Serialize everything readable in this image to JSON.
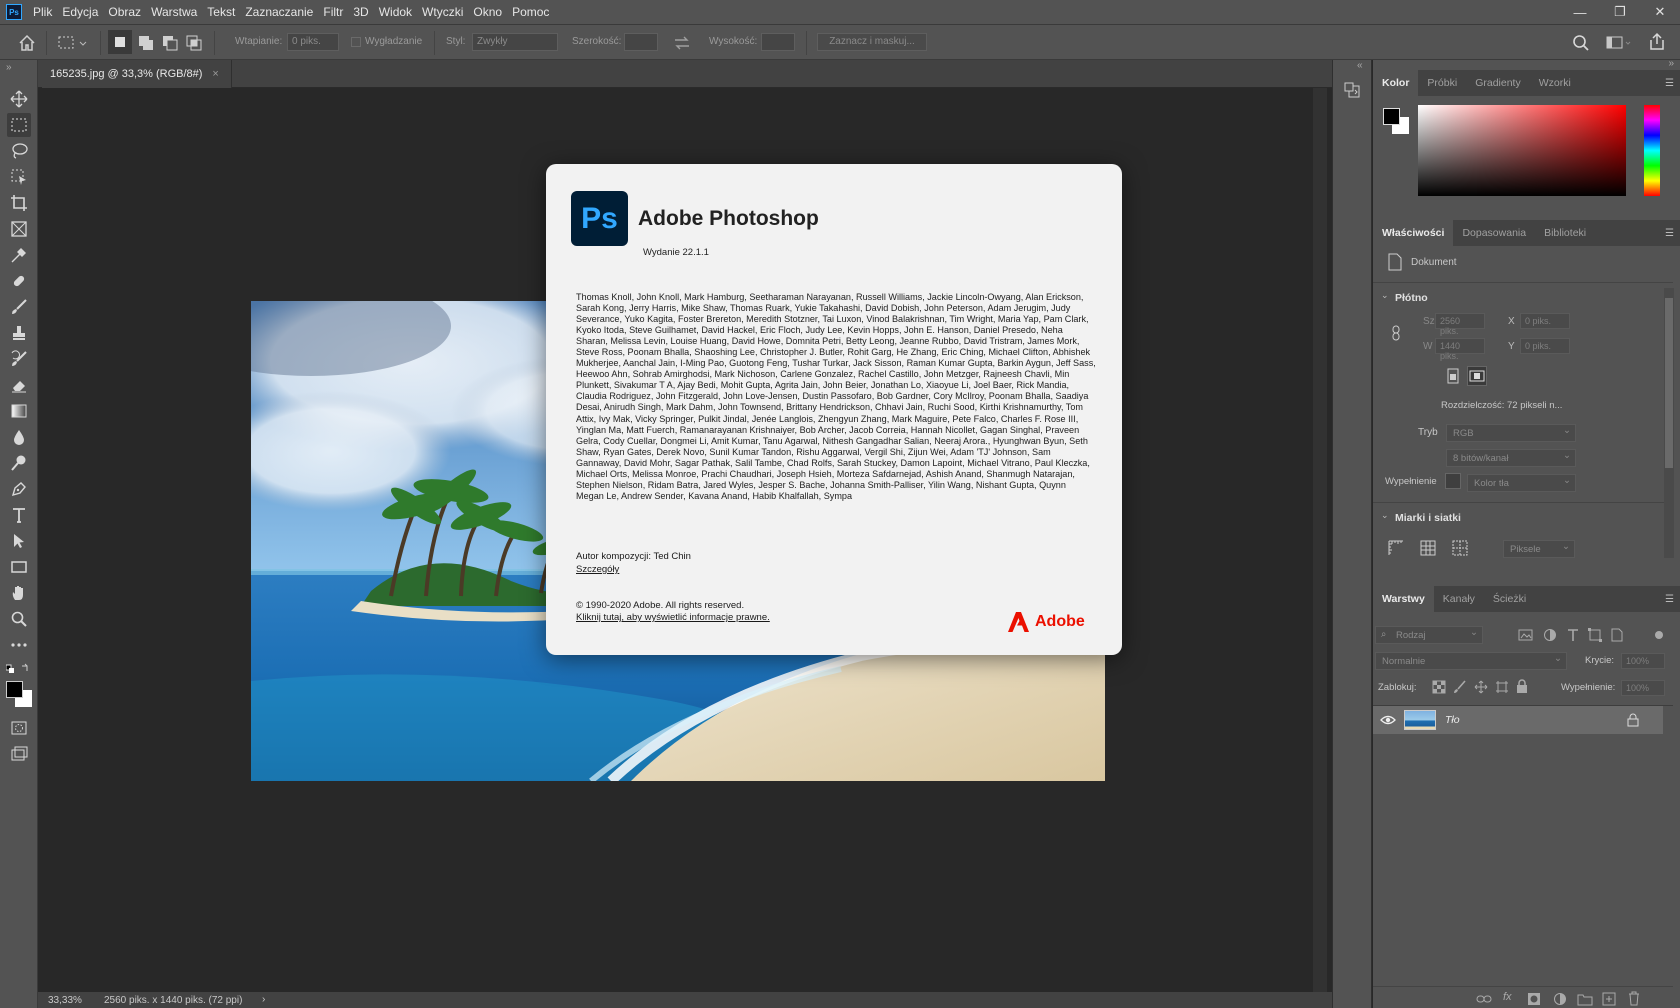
{
  "app": {
    "logo": "Ps"
  },
  "menu": [
    "Plik",
    "Edycja",
    "Obraz",
    "Warstwa",
    "Tekst",
    "Zaznaczanie",
    "Filtr",
    "3D",
    "Widok",
    "Wtyczki",
    "Okno",
    "Pomoc"
  ],
  "window_controls": {
    "minimize": "—",
    "restore": "❐",
    "close": "✕"
  },
  "options": {
    "feather_label": "Wtapianie:",
    "feather_value": "0 piks.",
    "antialias_label": "Wygładzanie",
    "style_label": "Styl:",
    "style_value": "Zwykły",
    "width_label": "Szerokość:",
    "height_label": "Wysokość:",
    "select_mask": "Zaznacz i maskuj..."
  },
  "document": {
    "tab_title": "165235.jpg @ 33,3% (RGB/8#)",
    "close": "×"
  },
  "status": {
    "zoom": "33,33%",
    "info": "2560 piks. x 1440 piks. (72 ppi)",
    "arrow": "›"
  },
  "color_panel": {
    "tabs": [
      "Kolor",
      "Próbki",
      "Gradienty",
      "Wzorki"
    ]
  },
  "properties_panel": {
    "tabs": [
      "Właściwości",
      "Dopasowania",
      "Biblioteki"
    ],
    "doc_label": "Dokument",
    "canvas_title": "Płótno",
    "w_label": "Sz",
    "w_value": "2560 piks.",
    "x_label": "X",
    "x_value": "0 piks.",
    "h_label": "W",
    "h_value": "1440 piks.",
    "y_label": "Y",
    "y_value": "0 piks.",
    "resolution": "Rozdzielczość: 72 pikseli n...",
    "mode_label": "Tryb",
    "mode_value": "RGB",
    "bits_value": "8 bitów/kanał",
    "fill_label": "Wypełnienie",
    "fill_value": "Kolor tła",
    "rulers_title": "Miarki i siatki",
    "units_value": "Piksele"
  },
  "layers_panel": {
    "tabs": [
      "Warstwy",
      "Kanały",
      "Ścieżki"
    ],
    "kind_placeholder": "Rodzaj",
    "blend_mode": "Normalnie",
    "opacity_label": "Krycie:",
    "opacity_value": "100%",
    "lock_label": "Zablokuj:",
    "fill_label": "Wypełnienie:",
    "fill_value": "100%",
    "layer_name": "Tło"
  },
  "about": {
    "logo": "Ps",
    "title": "Adobe Photoshop",
    "version": "Wydanie 22.1.1",
    "credits": "Thomas Knoll, John Knoll, Mark Hamburg, Seetharaman Narayanan, Russell Williams, Jackie Lincoln-Owyang, Alan Erickson, Sarah Kong, Jerry Harris, Mike Shaw, Thomas Ruark, Yukie Takahashi, David Dobish, John Peterson, Adam Jerugim, Judy Severance, Yuko Kagita, Foster Brereton, Meredith Stotzner, Tai Luxon, Vinod Balakrishnan, Tim Wright, Maria Yap, Pam Clark, Kyoko Itoda, Steve Guilhamet, David Hackel, Eric Floch, Judy Lee, Kevin Hopps, John E. Hanson, Daniel Presedo, Neha Sharan, Melissa Levin, Louise Huang, David Howe, Domnita Petri, Betty Leong, Jeanne Rubbo, David Tristram, James Mork, Steve Ross, Poonam Bhalla, Shaoshing Lee, Christopher J. Butler, Rohit Garg, He Zhang, Eric Ching, Michael Clifton, Abhishek Mukherjee, Aanchal Jain, I-Ming Pao, Guotong Feng, Tushar Turkar, Jack Sisson, Raman Kumar Gupta, Barkin Aygun, Jeff Sass, Heewoo Ahn, Sohrab Amirghodsi, Mark Nichoson, Carlene Gonzalez, Rachel Castillo, John Metzger, Rajneesh Chavli, Min Plunkett, Sivakumar T A, Ajay Bedi, Mohit Gupta, Agrita Jain, John Beier, Jonathan Lo, Xiaoyue Li, Joel Baer, Rick Mandia, Claudia Rodriguez, John Fitzgerald, John Love-Jensen, Dustin Passofaro, Bob Gardner, Cory McIlroy, Poonam Bhalla, Saadiya Desai, Anirudh Singh, Mark Dahm, John Townsend, Brittany Hendrickson, Chhavi Jain, Ruchi Sood, Kirthi Krishnamurthy, Tom Attix, Ivy Mak, Vicky Springer, Pulkit Jindal, Jenée Langlois, Zhengyun Zhang, Mark Maguire, Pete Falco, Charles F. Rose III, Yinglan Ma, Matt Fuerch, Ramanarayanan Krishnaiyer, Bob Archer, Jacob Correia, Hannah Nicollet, Gagan Singhal, Praveen Gelra, Cody Cuellar, Dongmei Li, Amit Kumar, Tanu Agarwal, Nithesh Gangadhar Salian, Neeraj Arora., Hyunghwan Byun, Seth Shaw, Ryan Gates, Derek Novo, Sunil Kumar Tandon, Rishu Aggarwal, Vergil Shi, Zijun Wei, Adam 'TJ' Johnson, Sam Gannaway, David Mohr, Sagar Pathak, Salil Tambe, Chad Rolfs, Sarah Stuckey, Damon Lapoint, Michael Vitrano, Paul Kleczka, Michael Orts, Melissa Monroe, Prachi Chaudhari, Joseph Hsieh, Morteza Safdarnejad, Ashish Anand, Shanmugh Natarajan, Stephen Nielson, Ridam Batra, Jared Wyles, Jesper S. Bache, Johanna Smith-Palliser, Yilin Wang, Nishant Gupta, Quynn Megan Le, Andrew Sender, Kavana Anand, Habib Khalfallah, Sympa",
    "author": "Autor kompozycji: Ted Chin",
    "details": "Szczegóły",
    "copyright": "© 1990-2020 Adobe. All rights reserved.",
    "legal": "Kliknij tutaj, aby wyświetlić informacje prawne.",
    "brand": "Adobe"
  },
  "colors": {
    "accent": "#31a8ff",
    "adobe_red": "#eb1000",
    "ui_bg": "#535353",
    "canvas_bg": "#282828"
  }
}
